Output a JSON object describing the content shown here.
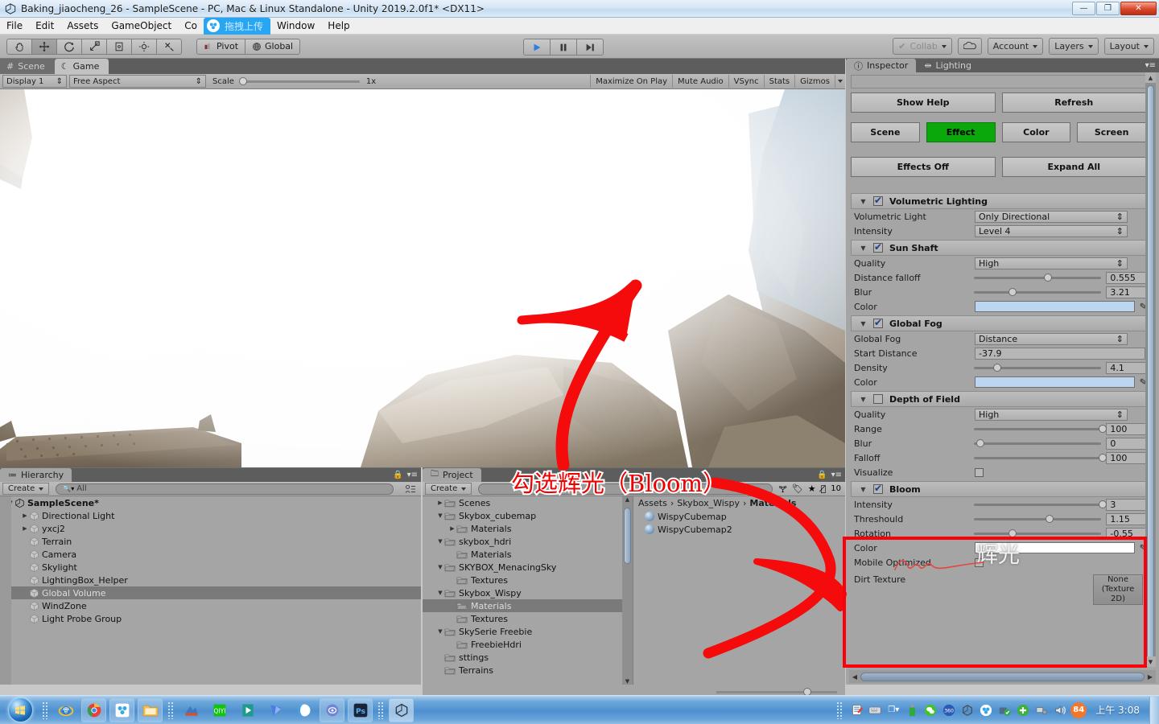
{
  "window": {
    "title": "Baking_jiaocheng_26 - SampleScene - PC, Mac & Linux Standalone - Unity 2019.2.0f1* <DX11>",
    "minimize": "—",
    "restore": "❐",
    "close": "✕"
  },
  "menubar": {
    "items": [
      "File",
      "Edit",
      "Assets",
      "GameObject",
      "Co"
    ],
    "upload_label": "拖拽上传",
    "right_items": [
      "Window",
      "Help"
    ]
  },
  "toolbar": {
    "tools": [
      "hand-tool",
      "move-tool",
      "rotate-tool",
      "scale-tool",
      "rect-tool",
      "transform-tool",
      "custom-tool"
    ],
    "pivot_label": "Pivot",
    "global_label": "Global",
    "play": "▶",
    "pause": "❙❙",
    "step": "▶❙",
    "collab_label": "Collab",
    "cloud_label": "cloud",
    "account_label": "Account",
    "layers_label": "Layers",
    "layout_label": "Layout"
  },
  "gameview": {
    "tabs": [
      {
        "label": "Scene",
        "active": false
      },
      {
        "label": "Game",
        "active": true
      }
    ],
    "display": "Display 1",
    "aspect": "Free Aspect",
    "scale_label": "Scale",
    "scale_value": "1x",
    "toggles": [
      "Maximize On Play",
      "Mute Audio",
      "VSync",
      "Stats",
      "Gizmos"
    ]
  },
  "hierarchy": {
    "tab_label": "Hierarchy",
    "create_label": "Create",
    "search_placeholder": "All",
    "items": [
      {
        "label": "SampleScene*",
        "depth": 0,
        "arrow": "▼",
        "root": true,
        "selected": false
      },
      {
        "label": "Directional Light",
        "depth": 1,
        "arrow": "▶",
        "root": false,
        "selected": false
      },
      {
        "label": "yxcj2",
        "depth": 1,
        "arrow": "▶",
        "root": false,
        "selected": false
      },
      {
        "label": "Terrain",
        "depth": 1,
        "arrow": "",
        "root": false,
        "selected": false
      },
      {
        "label": "Camera",
        "depth": 1,
        "arrow": "",
        "root": false,
        "selected": false
      },
      {
        "label": "Skylight",
        "depth": 1,
        "arrow": "",
        "root": false,
        "selected": false
      },
      {
        "label": "LightingBox_Helper",
        "depth": 1,
        "arrow": "",
        "root": false,
        "selected": false
      },
      {
        "label": "Global Volume",
        "depth": 1,
        "arrow": "",
        "root": false,
        "selected": true
      },
      {
        "label": "WindZone",
        "depth": 1,
        "arrow": "",
        "root": false,
        "selected": false
      },
      {
        "label": "Light Probe Group",
        "depth": 1,
        "arrow": "",
        "root": false,
        "selected": false
      }
    ]
  },
  "project": {
    "tab_label": "Project",
    "create_label": "Create",
    "hidden_count": "10",
    "tree": [
      {
        "label": "Scenes",
        "depth": 1,
        "arrow": "▶",
        "selected": false
      },
      {
        "label": "Skybox_cubemap",
        "depth": 1,
        "arrow": "▼",
        "selected": false
      },
      {
        "label": "Materials",
        "depth": 2,
        "arrow": "▶",
        "selected": false
      },
      {
        "label": "skybox_hdri",
        "depth": 1,
        "arrow": "▼",
        "selected": false
      },
      {
        "label": "Materials",
        "depth": 2,
        "arrow": "",
        "selected": false
      },
      {
        "label": "SKYBOX_MenacingSky",
        "depth": 1,
        "arrow": "▼",
        "selected": false
      },
      {
        "label": "Textures",
        "depth": 2,
        "arrow": "",
        "selected": false
      },
      {
        "label": "Skybox_Wispy",
        "depth": 1,
        "arrow": "▼",
        "selected": false
      },
      {
        "label": "Materials",
        "depth": 2,
        "arrow": "",
        "selected": true
      },
      {
        "label": "Textures",
        "depth": 2,
        "arrow": "",
        "selected": false
      },
      {
        "label": "SkySerie Freebie",
        "depth": 1,
        "arrow": "▼",
        "selected": false
      },
      {
        "label": "FreebieHdri",
        "depth": 2,
        "arrow": "",
        "selected": false
      },
      {
        "label": "sttings",
        "depth": 1,
        "arrow": "",
        "selected": false
      },
      {
        "label": "Terrains",
        "depth": 1,
        "arrow": "",
        "selected": false
      }
    ],
    "breadcrumb": [
      "Assets",
      "Skybox_Wispy",
      "Materials"
    ],
    "assets": [
      "WispyCubemap",
      "WispyCubemap2"
    ]
  },
  "inspector": {
    "tabs": [
      {
        "label": "Inspector",
        "active": true
      },
      {
        "label": "Lighting",
        "active": false
      }
    ],
    "object_field_value": "",
    "top_buttons": [
      "Show Help",
      "Refresh"
    ],
    "category_buttons": [
      {
        "label": "Scene",
        "active": false
      },
      {
        "label": "Effect",
        "active": true
      },
      {
        "label": "Color",
        "active": false
      },
      {
        "label": "Screen",
        "active": false
      }
    ],
    "action_buttons": [
      "Effects Off",
      "Expand All"
    ],
    "active_color": "#0aa80a",
    "sections": [
      {
        "name": "Volumetric Lighting",
        "checked": true,
        "rows": [
          {
            "label": "Volumetric Light",
            "type": "dropdown",
            "value": "Only Directional"
          },
          {
            "label": "Intensity",
            "type": "dropdown",
            "value": "Level 4"
          }
        ]
      },
      {
        "name": "Sun Shaft",
        "checked": true,
        "rows": [
          {
            "label": "Quality",
            "type": "dropdown",
            "value": "High"
          },
          {
            "label": "Distance falloff",
            "type": "slider",
            "value": "0.555",
            "pos": 55
          },
          {
            "label": "Blur",
            "type": "slider",
            "value": "3.21",
            "pos": 27
          },
          {
            "label": "Color",
            "type": "color",
            "value": "#bcd6f2"
          }
        ]
      },
      {
        "name": "Global Fog",
        "checked": true,
        "rows": [
          {
            "label": "Global Fog",
            "type": "dropdown",
            "value": "Distance"
          },
          {
            "label": "Start Distance",
            "type": "text",
            "value": "-37.9"
          },
          {
            "label": "Density",
            "type": "slider",
            "value": "4.1",
            "pos": 15
          },
          {
            "label": "Color",
            "type": "color",
            "value": "#bcd6f2"
          }
        ]
      },
      {
        "name": "Depth of Field",
        "checked": false,
        "rows": [
          {
            "label": "Quality",
            "type": "dropdown",
            "value": "High"
          },
          {
            "label": "Range",
            "type": "slider",
            "value": "100",
            "pos": 98
          },
          {
            "label": "Blur",
            "type": "slider",
            "value": "0",
            "pos": 2
          },
          {
            "label": "Falloff",
            "type": "slider",
            "value": "100",
            "pos": 98
          },
          {
            "label": "Visualize",
            "type": "checkbox",
            "value": ""
          }
        ]
      },
      {
        "name": "Bloom",
        "checked": true,
        "highlighted": true,
        "rows": [
          {
            "label": "Intensity",
            "type": "slider",
            "value": "3",
            "pos": 98
          },
          {
            "label": "Threshould",
            "type": "slider",
            "value": "1.15",
            "pos": 56
          },
          {
            "label": "Rotation",
            "type": "slider",
            "value": "-0.55",
            "pos": 27
          },
          {
            "label": "Color",
            "type": "color",
            "value": "#ffffff"
          },
          {
            "label": "Mobile Optimized",
            "type": "checkbox",
            "value": ""
          },
          {
            "label": "Dirt Texture",
            "type": "object",
            "value": "None\n(Texture\n2D)"
          }
        ]
      }
    ]
  },
  "annotations": {
    "callout_text": "勾选辉光（Bloom）",
    "callout_color": "#ee0000",
    "bloom_overlay_text": "辉光",
    "highlight_box_color": "#fb0008"
  },
  "taskbar": {
    "start_label": "start-orb",
    "pinned": [
      "ie-icon",
      "chrome-icon",
      "baidu-cloud-icon",
      "explorer-icon"
    ],
    "running": [
      "winrar-icon",
      "qq-music-icon",
      "editor-icon",
      "downloader-icon",
      "browser-icon",
      "player-icon",
      "photoshop-icon",
      "unity-icon"
    ],
    "tray": [
      "notes-icon",
      "keyboard-icon",
      "usb-icon",
      "wechat-icon",
      "blue-circle-icon",
      "unity-tray-icon",
      "cloud-tray-icon",
      "safe-icon",
      "plus-icon",
      "network-icon",
      "volume-icon"
    ],
    "badge": "84",
    "clock": "上午 3:08"
  }
}
